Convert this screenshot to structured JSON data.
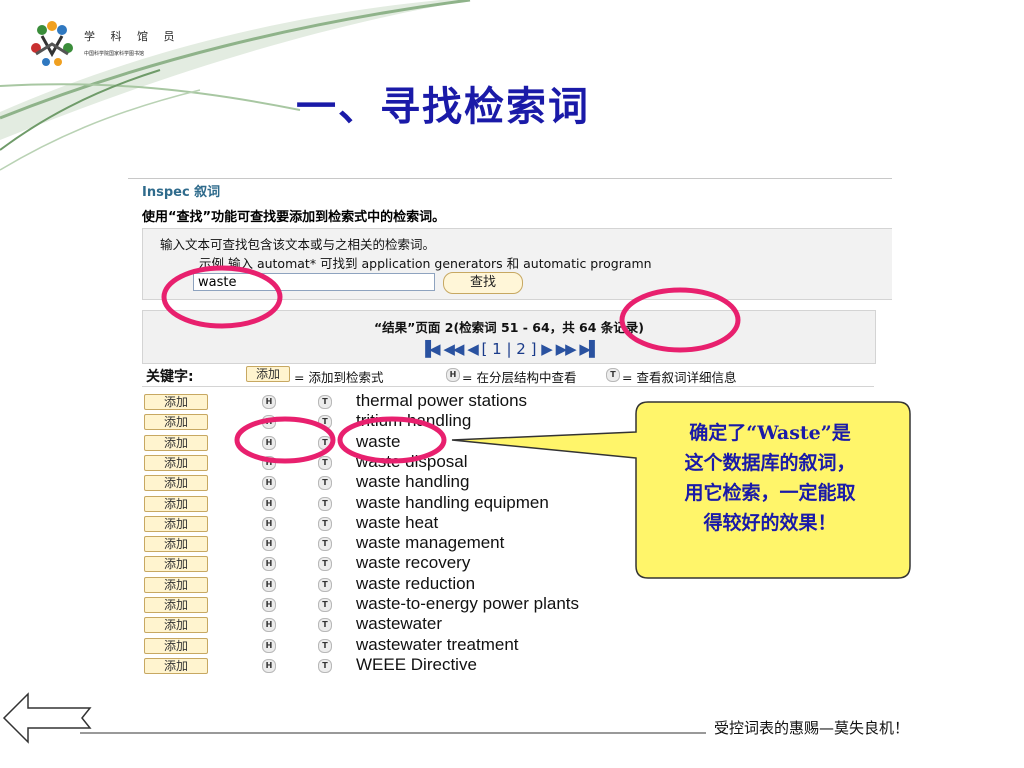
{
  "logo": {
    "title": "学 科 馆 员",
    "subtitle": "中国科学院国家科学图书馆"
  },
  "slide": {
    "title": "一、寻找检索词"
  },
  "inspec": {
    "title": "Inspec 叙词",
    "description": "使用“查找”功能可查找要添加到检索式中的检索词。",
    "search": {
      "hint_line1": "输入文本可查找包含该文本或与之相关的检索词。",
      "hint_line2": "示例  输入  automat* 可找到  application generators 和  automatic programn",
      "input_value": "waste",
      "button_label": "查找"
    },
    "results": {
      "caption": "“结果”页面 2(检索词  51 - 64，共  64 条记录)",
      "pager_text": "[ 1 | 2 ]"
    },
    "legend": {
      "keyword_label": "关键字:",
      "add_sample": "添加",
      "add_desc": "= 添加到检索式",
      "h_desc": "= 在分层结构中查看",
      "t_desc": "= 查看叙词详细信息"
    },
    "add_label": "添加",
    "h_label": "H",
    "t_label": "T",
    "terms": [
      "thermal power stations",
      "tritium handling",
      "waste",
      "waste disposal",
      "waste handling",
      "waste handling equipmen",
      "waste heat",
      "waste management",
      "waste recovery",
      "waste reduction",
      "waste-to-energy power plants",
      "wastewater",
      "wastewater treatment",
      "WEEE Directive"
    ]
  },
  "callout": {
    "line1": "确定了“Waste”是",
    "line2": "这个数据库的叙词，",
    "line3": "用它检索，一定能取",
    "line4": "得较好的效果！"
  },
  "footer": {
    "text": "受控词表的惠赐—莫失良机！"
  },
  "colors": {
    "title_blue": "#1a1aa8",
    "accent_green": "#7fa878",
    "highlight_pink": "#e8206e",
    "callout_fill": "#fff56a",
    "inspec_title": "#2f6b8c"
  }
}
